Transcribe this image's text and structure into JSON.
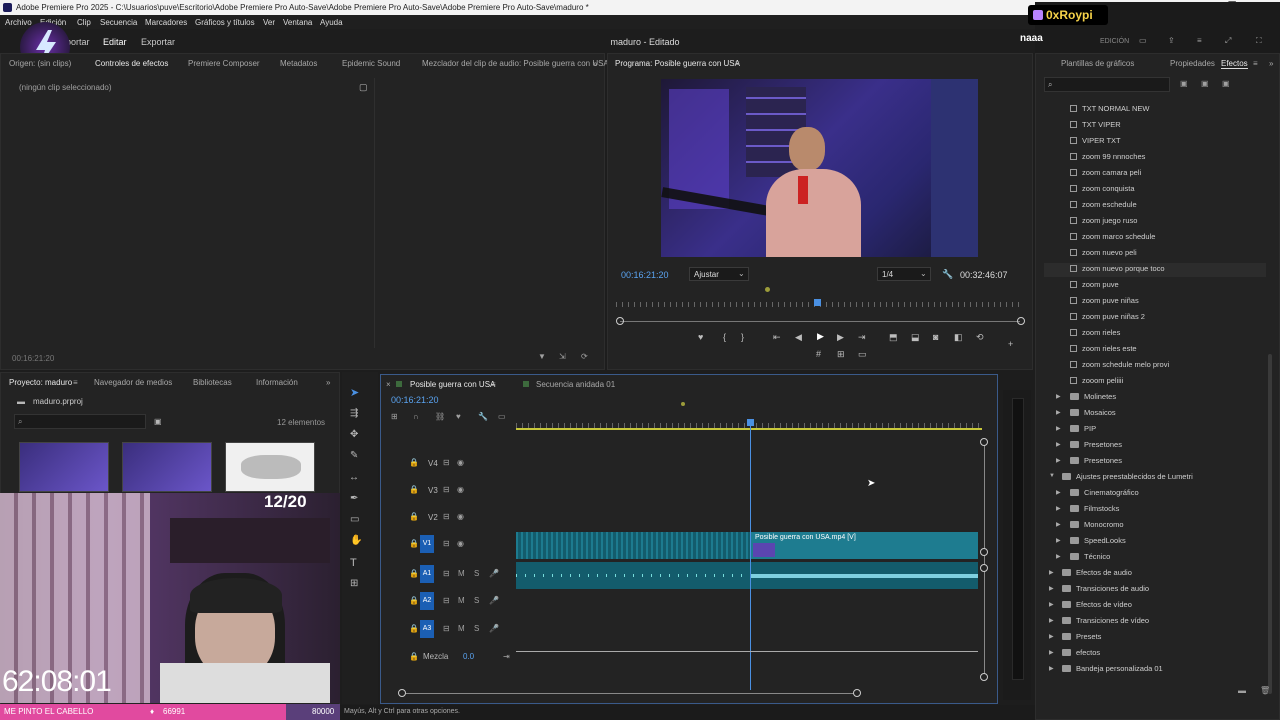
{
  "window": {
    "title": "Adobe Premiere Pro 2025 - C:\\Usuarios\\puve\\Escritorio\\Adobe Premiere Pro Auto-Save\\Adobe Premiere Pro Auto-Save\\Adobe Premiere Pro Auto-Save\\maduro *"
  },
  "menu": [
    "Archivo",
    "Edición",
    "Clip",
    "Secuencia",
    "Marcadores",
    "Gráficos y títulos",
    "Ver",
    "Ventana",
    "Ayuda"
  ],
  "workspace": {
    "tabs": [
      "Importar",
      "Editar",
      "Exportar"
    ],
    "center": "maduro - Editado",
    "right_label": "EDICIÓN"
  },
  "stream": {
    "username": "0xRoypi",
    "tagline": "naaa",
    "counter": "12/20",
    "timer": "62:08:01",
    "goal_label": "ME PINTO EL CABELLO",
    "goal_current": "66991",
    "goal_target": "80000"
  },
  "source_panel": {
    "tabs": [
      "Origen: (sin clips)",
      "Controles de efectos",
      "Premiere Composer",
      "Metadatos",
      "Epidemic Sound",
      "Mezclador del clip de audio: Posible guerra con USA"
    ],
    "empty_msg": "(ningún clip seleccionado)",
    "timecode": "00:16:21:20"
  },
  "program": {
    "title": "Programa: Posible guerra con USA",
    "timecode": "00:16:21:20",
    "fit": "Ajustar",
    "quality": "1/4",
    "duration": "00:32:46:07"
  },
  "project": {
    "tabs": [
      "Proyecto: maduro",
      "Navegador de medios",
      "Bibliotecas",
      "Información"
    ],
    "file": "maduro.prproj",
    "count": "12 elementos"
  },
  "timeline": {
    "tabs": [
      "Posible guerra con USA",
      "Secuencia anidada 01"
    ],
    "timecode": "00:16:21:20",
    "video_tracks": [
      "V4",
      "V3",
      "V2",
      "V1"
    ],
    "audio_tracks": [
      "A1",
      "A2",
      "A3"
    ],
    "clip_label": "Posible guerra con USA.mp4 [V]",
    "mix_label": "Mezcla",
    "mix_value": "0.0"
  },
  "status": {
    "text": "Mayús, Alt y Ctrl para otras opciones."
  },
  "effects": {
    "tabs": [
      "Plantillas de gráficos",
      "Propiedades",
      "Efectos"
    ],
    "presets": [
      "TXT NORMAL NEW",
      "TXT VIPER",
      "VIPER TXT",
      "zoom 99 nnnoches",
      "zoom camara peli",
      "zoom conquista",
      "zoom eschedule",
      "zoom juego ruso",
      "zoom marco schedule",
      "zoom nuevo peli",
      "zoom nuevo porque toco",
      "zoom puve",
      "zoom puve niñas",
      "zoom puve niñas 2",
      "zoom rieles",
      "zoom rieles este",
      "zoom schedule melo provi",
      "zooom peliiii"
    ],
    "folders1": [
      "Molinetes",
      "Mosaicos",
      "PIP",
      "Presetones",
      "Presetones"
    ],
    "lumetri": "Ajustes preestablecidos de Lumetri",
    "lumetri_items": [
      "Cinematográfico",
      "Filmstocks",
      "Monocromo",
      "SpeedLooks",
      "Técnico"
    ],
    "root": [
      "Efectos de audio",
      "Transiciones de audio",
      "Efectos de vídeo",
      "Transiciones de vídeo",
      "Presets",
      "efectos",
      "Bandeja personalizada 01"
    ]
  }
}
